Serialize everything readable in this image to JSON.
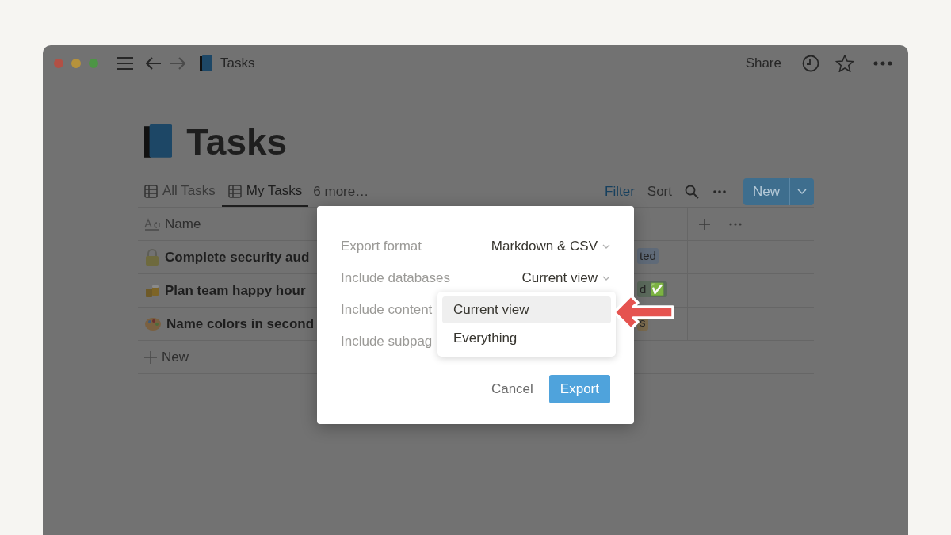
{
  "window": {
    "title": "Tasks",
    "share": "Share"
  },
  "page": {
    "title": "Tasks"
  },
  "views": [
    {
      "label": "All Tasks",
      "selected": false
    },
    {
      "label": "My Tasks",
      "selected": true
    }
  ],
  "more_views": "6 more…",
  "toolbar": {
    "filter": "Filter",
    "sort": "Sort",
    "new": "New"
  },
  "table": {
    "columns": [
      {
        "label": "Name"
      }
    ],
    "rows": [
      {
        "kind": "lock",
        "name": "Complete security aud",
        "status": "ted",
        "color": "#5f6a78"
      },
      {
        "kind": "mugs",
        "name": "Plan team happy hour",
        "status": "d ✅",
        "color": "#5b6a5c"
      },
      {
        "kind": "palette",
        "name": "Name colors in second",
        "status": "s",
        "color": "#7a6a4e"
      }
    ],
    "new_row": "New"
  },
  "dialog": {
    "settings": [
      {
        "label": "Export format",
        "value": "Markdown & CSV"
      },
      {
        "label": "Include databases",
        "value": "Current view"
      },
      {
        "label": "Include content"
      },
      {
        "label": "Include subpag"
      }
    ],
    "cancel": "Cancel",
    "export": "Export"
  },
  "dropdown": {
    "options": [
      {
        "label": "Current view",
        "selected": true
      },
      {
        "label": "Everything",
        "selected": false
      }
    ]
  }
}
